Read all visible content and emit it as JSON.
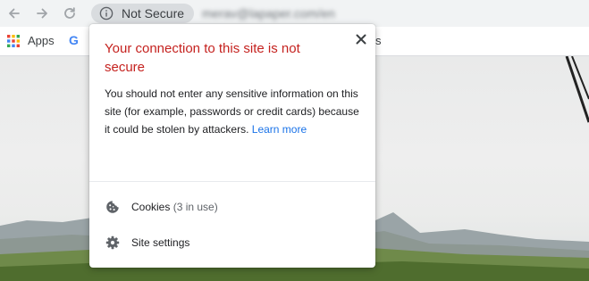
{
  "toolbar": {
    "security_label": "Not Secure",
    "url": "merav@lapaper.com/en"
  },
  "bookmarks": {
    "apps_label": "Apps",
    "google_letter": "G",
    "trailing_fragment": "s"
  },
  "popup": {
    "title": "Your connection to this site is not secure",
    "body": "You should not enter any sensitive information on this site (for example, passwords or credit cards) because it could be stolen by attackers.",
    "learn_more": "Learn more",
    "cookies_label": "Cookies",
    "cookies_count": "(3 in use)",
    "site_settings_label": "Site settings",
    "colors": {
      "title": "#c5221f",
      "link": "#1a73e8"
    }
  },
  "icons": [
    "back-arrow-icon",
    "forward-arrow-icon",
    "reload-icon",
    "info-icon",
    "apps-grid-icon",
    "google-icon",
    "close-icon",
    "cookie-icon",
    "gear-icon"
  ]
}
